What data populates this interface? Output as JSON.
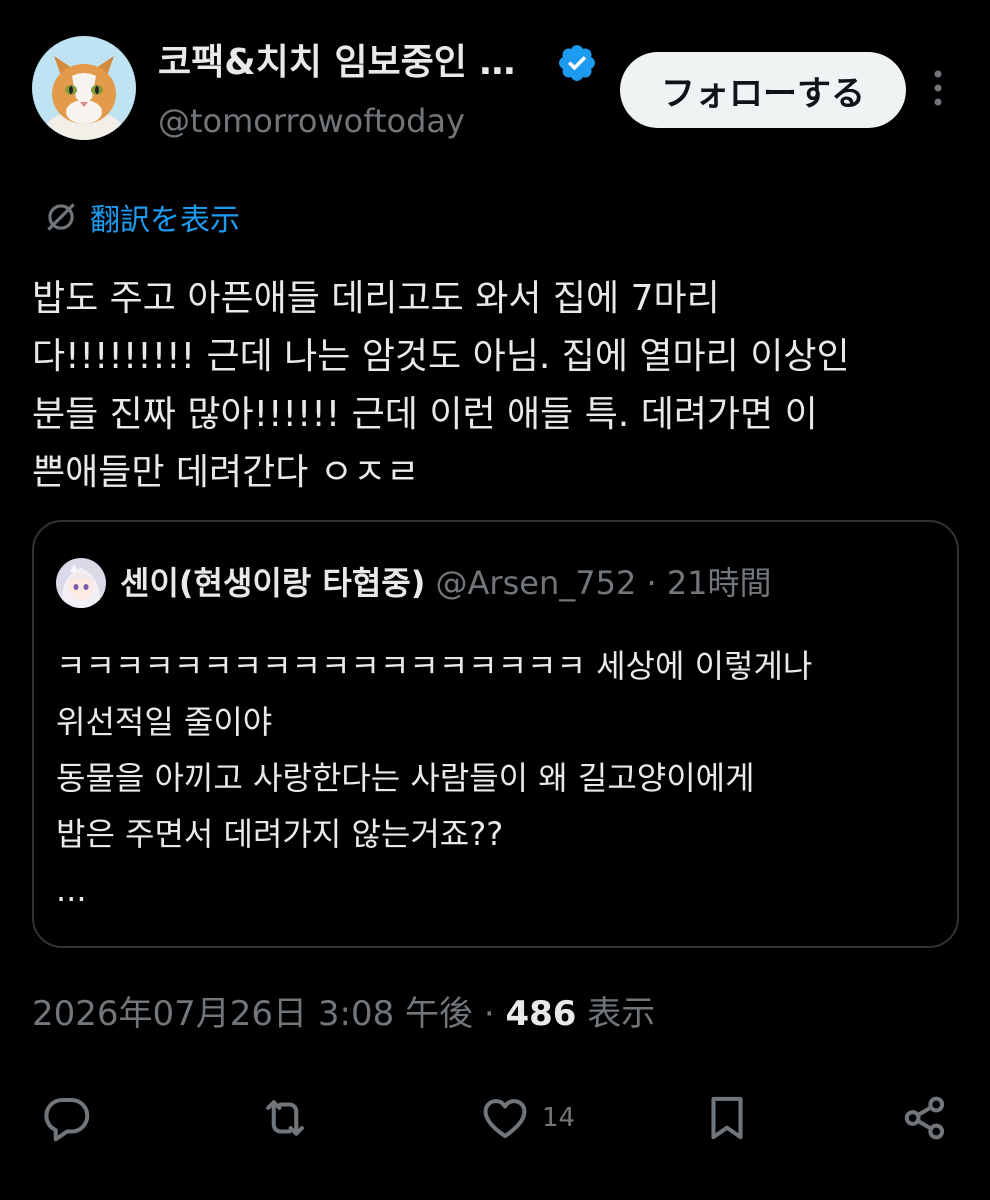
{
  "author": {
    "display_name": "코팩&치치 임보중인 …",
    "handle": "@tomorrowoftoday",
    "avatar": "orange-white-cat-avatar",
    "verified_icon": "verified-badge-icon",
    "verified_color": "#1d9bf0"
  },
  "follow_button": {
    "label": "フォローする"
  },
  "translate": {
    "label": "翻訳を表示"
  },
  "tweet": {
    "lines": [
      "밥도 주고 아픈애들 데리고도 와서 집에 7마리",
      "다!!!!!!!!! 근데 나는 암것도 아님. 집에 열마리 이상인",
      "분들 진짜 많아!!!!!! 근데 이런 애들 특. 데려가면 이",
      "쁜애들만 데려간다 ㅇㅈㄹ"
    ]
  },
  "quote": {
    "display_name": "센이(현생이랑 타협중)",
    "handle": "@Arsen_752",
    "separator": "·",
    "time": "21時間",
    "lines": [
      "ㅋㅋㅋㅋㅋㅋㅋㅋㅋㅋㅋㅋㅋㅋㅋㅋㅋㅋ 세상에 이렇게나",
      "위선적일 줄이야",
      "동물을 아끼고 사랑한다는 사람들이 왜 길고양이에게",
      "밥은 주면서 데려가지 않는거죠??",
      "..."
    ]
  },
  "meta": {
    "date": "2026年07月26日 3:08 午後",
    "separator": "·",
    "views": "486",
    "views_label": "表示"
  },
  "actions": {
    "like_count": "14",
    "icons": [
      "reply-icon",
      "retweet-icon",
      "like-icon",
      "bookmark-icon",
      "share-icon"
    ]
  },
  "colors": {
    "background": "#000000",
    "text": "#e7e9ea",
    "secondary": "#71767b",
    "accent": "#1d9bf0",
    "border": "#2f3336"
  }
}
